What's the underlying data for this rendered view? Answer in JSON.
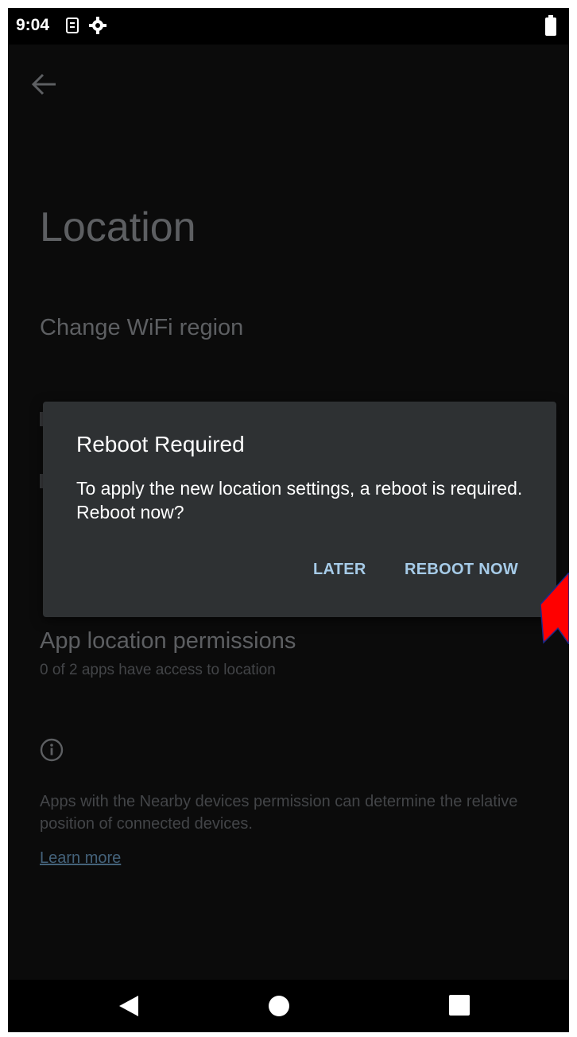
{
  "status_bar": {
    "time": "9:04",
    "icons": [
      "sim-icon",
      "settings-icon",
      "battery-icon"
    ]
  },
  "settings_page": {
    "title": "Location",
    "wifi_region_label": "Change WiFi region",
    "app_permissions": {
      "title": "App location permissions",
      "subtitle": "0 of 2 apps have access to location"
    },
    "nearby_text": "Apps with the Nearby devices permission can determine the relative position of connected devices.",
    "learn_more": "Learn more"
  },
  "dialog": {
    "title": "Reboot Required",
    "message": "To apply the new location settings, a reboot is required. Reboot now?",
    "later_label": "LATER",
    "reboot_now_label": "REBOOT NOW"
  },
  "colors": {
    "background": "#0b0b0b",
    "dialog": "#2e3133",
    "accent": "#a6cbe8",
    "annotation": "#ff0000"
  },
  "nav_bar": {
    "icons": [
      "back-triangle-icon",
      "home-circle-icon",
      "recents-square-icon"
    ]
  }
}
